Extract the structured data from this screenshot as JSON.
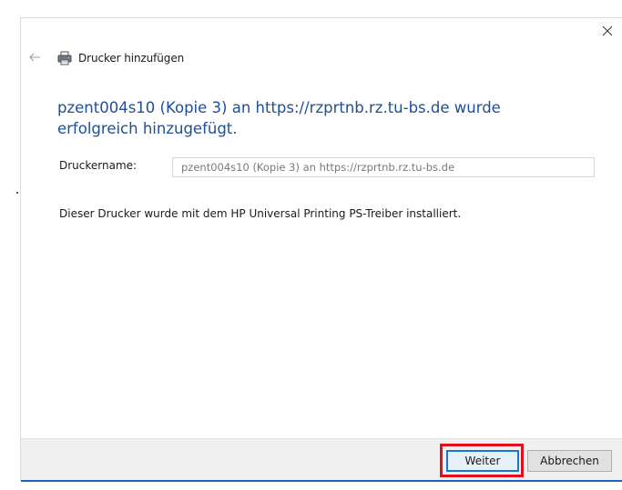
{
  "window": {
    "title": "Drucker hinzufügen",
    "close_label": "✕",
    "back_label": "←"
  },
  "main": {
    "headline": "pzent004s10 (Kopie 3) an https://rzprtnb.rz.tu-bs.de wurde erfolgreich hinzugefügt.",
    "printer_name_label": "Druckername:",
    "printer_name_value": "pzent004s10 (Kopie 3) an https://rzprtnb.rz.tu-bs.de",
    "info": "Dieser Drucker wurde mit dem HP Universal Printing PS-Treiber installiert."
  },
  "footer": {
    "next_label": "Weiter",
    "cancel_label": "Abbrechen"
  },
  "colors": {
    "accent": "#1e4f97",
    "highlight": "#e0101d",
    "focus": "#1677d2"
  },
  "icons": {
    "back": "back-arrow-icon",
    "printer": "printer-icon",
    "close": "close-icon"
  }
}
